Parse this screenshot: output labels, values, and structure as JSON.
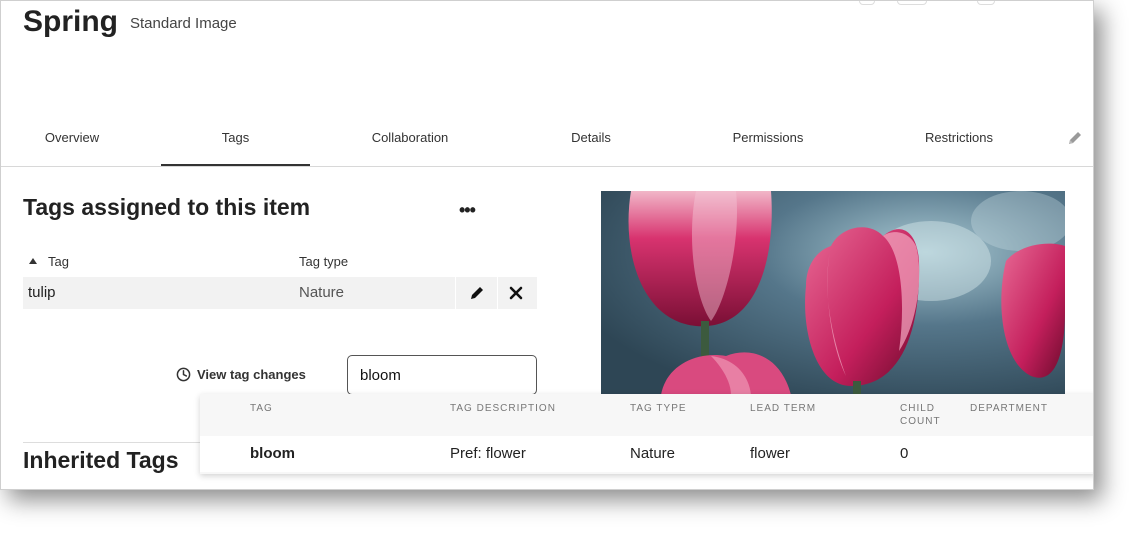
{
  "header": {
    "title": "Spring",
    "subtitle": "Standard Image"
  },
  "tabs": [
    {
      "label": "Overview"
    },
    {
      "label": "Tags"
    },
    {
      "label": "Collaboration"
    },
    {
      "label": "Details"
    },
    {
      "label": "Permissions"
    },
    {
      "label": "Restrictions"
    }
  ],
  "active_tab": "Tags",
  "tags_section": {
    "title": "Tags assigned to this item",
    "columns": {
      "tag": "Tag",
      "tag_type": "Tag type"
    },
    "rows": [
      {
        "tag": "tulip",
        "tag_type": "Nature"
      }
    ]
  },
  "history": {
    "label": "View tag changes"
  },
  "search": {
    "value": "bloom"
  },
  "inherited": {
    "title": "Inherited Tags"
  },
  "suggestions": {
    "columns": {
      "tag": "TAG",
      "description": "TAG DESCRIPTION",
      "type": "TAG TYPE",
      "lead_term": "LEAD TERM",
      "child_count_1": "CHILD",
      "child_count_2": "COUNT",
      "department": "DEPARTMENT"
    },
    "rows": [
      {
        "tag": "bloom",
        "description": "Pref: flower",
        "type": "Nature",
        "lead_term": "flower",
        "child_count": "0",
        "department": ""
      }
    ]
  },
  "icons": {
    "edit_tab": "pencil-icon",
    "more": "more-horizontal-icon",
    "sort": "sort-ascending-icon",
    "row_edit": "pencil-icon",
    "row_delete": "close-icon",
    "history": "clock-icon"
  },
  "colors": {
    "active_tab_underline": "#333333",
    "row_background": "#f2f2f2",
    "tulip_pink": "#d8336f"
  }
}
